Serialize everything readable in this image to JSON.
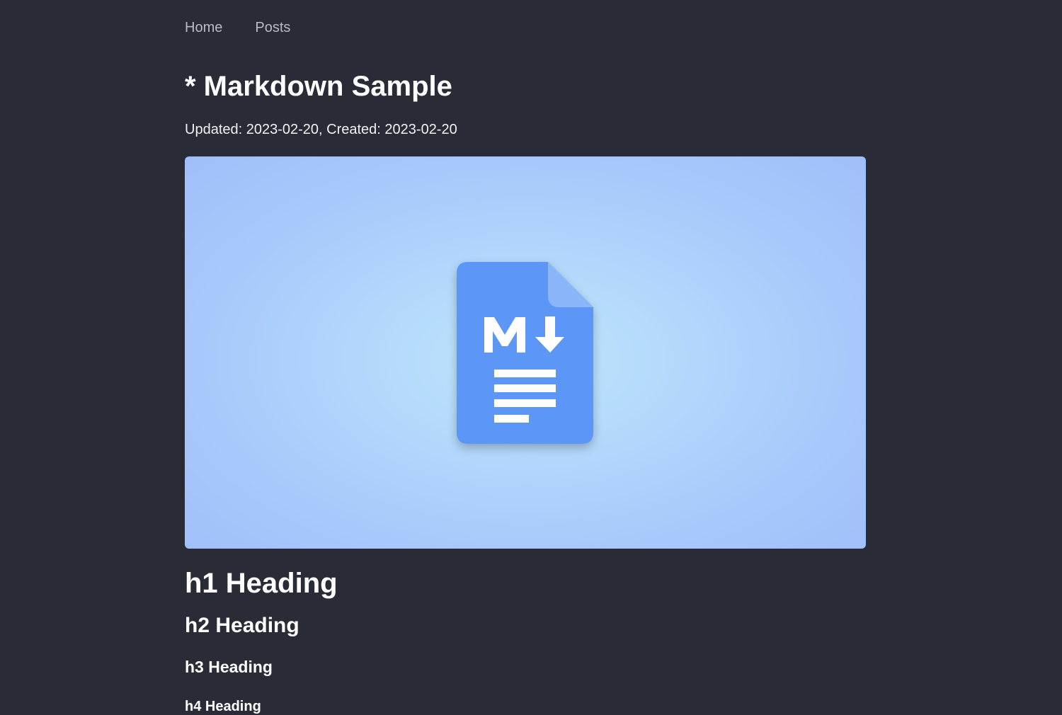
{
  "nav": {
    "items": [
      {
        "label": "Home"
      },
      {
        "label": "Posts"
      }
    ]
  },
  "post": {
    "title": "* Markdown Sample",
    "meta": "Updated: 2023-02-20, Created: 2023-02-20",
    "hero_icon": "markdown-document-icon",
    "headings": {
      "h1": "h1 Heading",
      "h2": "h2 Heading",
      "h3": "h3 Heading",
      "h4": "h4 Heading"
    }
  },
  "colors": {
    "background": "#292b37",
    "nav_text": "#b8bac4",
    "icon_blue": "#5c96f6"
  }
}
